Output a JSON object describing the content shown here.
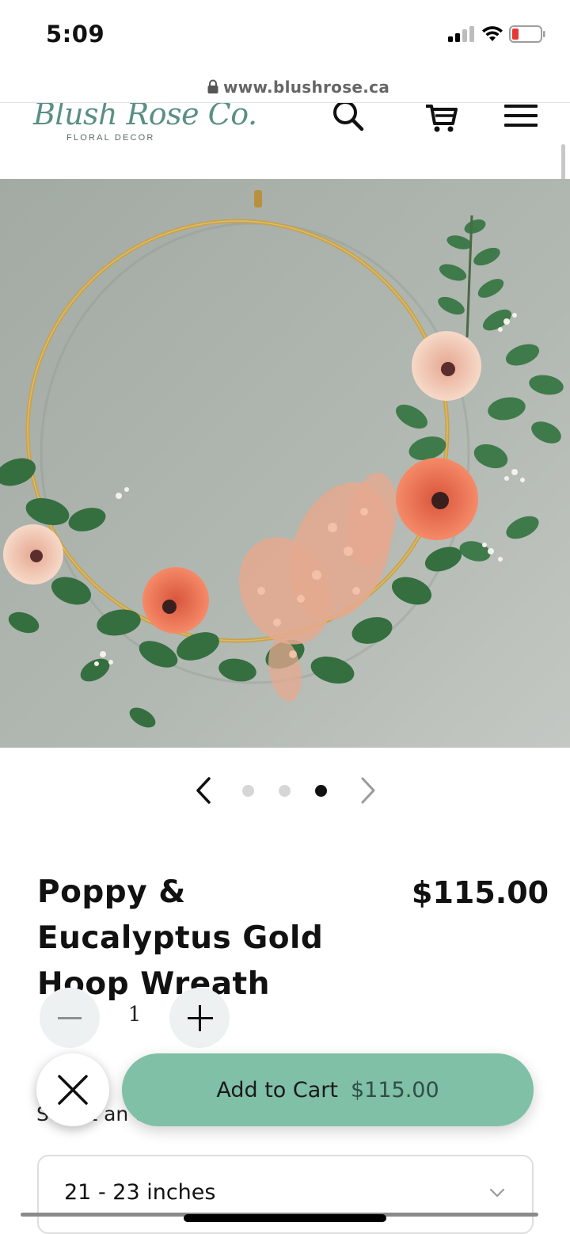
{
  "status_bar": {
    "time": "5:09",
    "signal_icon": "cellular-signal-icon",
    "wifi_icon": "wifi-icon",
    "battery_icon": "battery-low-icon",
    "battery_color": "#e53935"
  },
  "browser": {
    "url": "www.blushrose.ca",
    "lock_icon": "lock-icon"
  },
  "header": {
    "logo_script": "Blush Rose Co.",
    "logo_tagline": "FLORAL DECOR",
    "icons": [
      "search-icon",
      "cart-icon",
      "menu-icon"
    ]
  },
  "carousel": {
    "prev_icon": "chevron-left-icon",
    "next_icon": "chevron-right-icon",
    "total": 3,
    "active_index": 3
  },
  "product": {
    "title": "Poppy & Eucalyptus Gold Hoop Wreath",
    "price": "$115.00",
    "quantity": "1"
  },
  "option": {
    "label": "Select an option",
    "selected": "21 - 23 inches"
  },
  "cta": {
    "add_to_cart_label": "Add to Cart",
    "add_to_cart_price": "$115.00",
    "close_icon": "close-icon",
    "accent_color": "#80c0a6"
  },
  "colors": {
    "brand_teal": "#5a8f86",
    "wall_gray": "#aab0aa",
    "gold_hoop": "#c9a24a",
    "poppy_coral": "#f07a5c",
    "blush_pink": "#f3c9b6"
  }
}
